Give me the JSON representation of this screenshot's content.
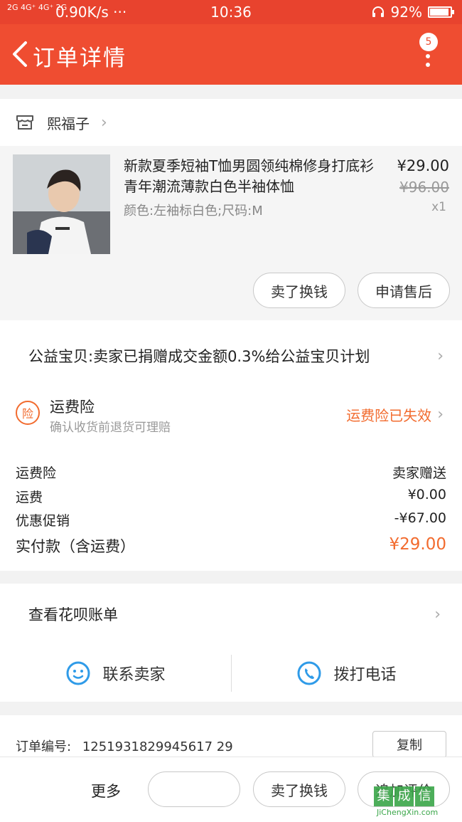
{
  "status_bar": {
    "signal": "2G 4G⁺ 4G⁺ 2G",
    "speed": "0.90K/s ···",
    "time": "10:36",
    "battery": "92%",
    "battery_level": 0.92
  },
  "nav": {
    "title": "订单详情",
    "badge": "5"
  },
  "shop": {
    "name": "熙福子"
  },
  "product": {
    "title": "新款夏季短袖T恤男圆领纯棉修身打底衫青年潮流薄款白色半袖体恤",
    "attrs": "颜色:左袖标白色;尺码:M",
    "price": "¥29.00",
    "original_price": "¥96.00",
    "quantity": "x1",
    "buttons": [
      "卖了换钱",
      "申请售后"
    ]
  },
  "charity": {
    "text": "公益宝贝:卖家已捐赠成交金额0.3%给公益宝贝计划"
  },
  "insurance": {
    "icon_text": "险",
    "title": "运费险",
    "subtitle": "确认收货前退货可理赔",
    "status": "运费险已失效"
  },
  "fees": [
    {
      "label": "运费险",
      "value": "卖家赠送"
    },
    {
      "label": "运费",
      "value": "¥0.00"
    },
    {
      "label": "优惠促销",
      "value": "-¥67.00"
    },
    {
      "label": "实付款（含运费）",
      "value": "¥29.00"
    }
  ],
  "huabei": {
    "text": "查看花呗账单"
  },
  "contact": {
    "seller": "联系卖家",
    "phone": "拨打电话"
  },
  "order": {
    "label": "订单编号:",
    "number": "1251931829945617 29",
    "copy": "复制"
  },
  "bottom": {
    "more": "更多",
    "sell": "卖了换钱",
    "review": "追加评价"
  },
  "watermark": {
    "logo": "集成信",
    "url": "JiChengXin.com"
  },
  "colors": {
    "header": "#ef4d31",
    "accent": "#f26b2e",
    "icon_blue": "#2f9be8"
  }
}
